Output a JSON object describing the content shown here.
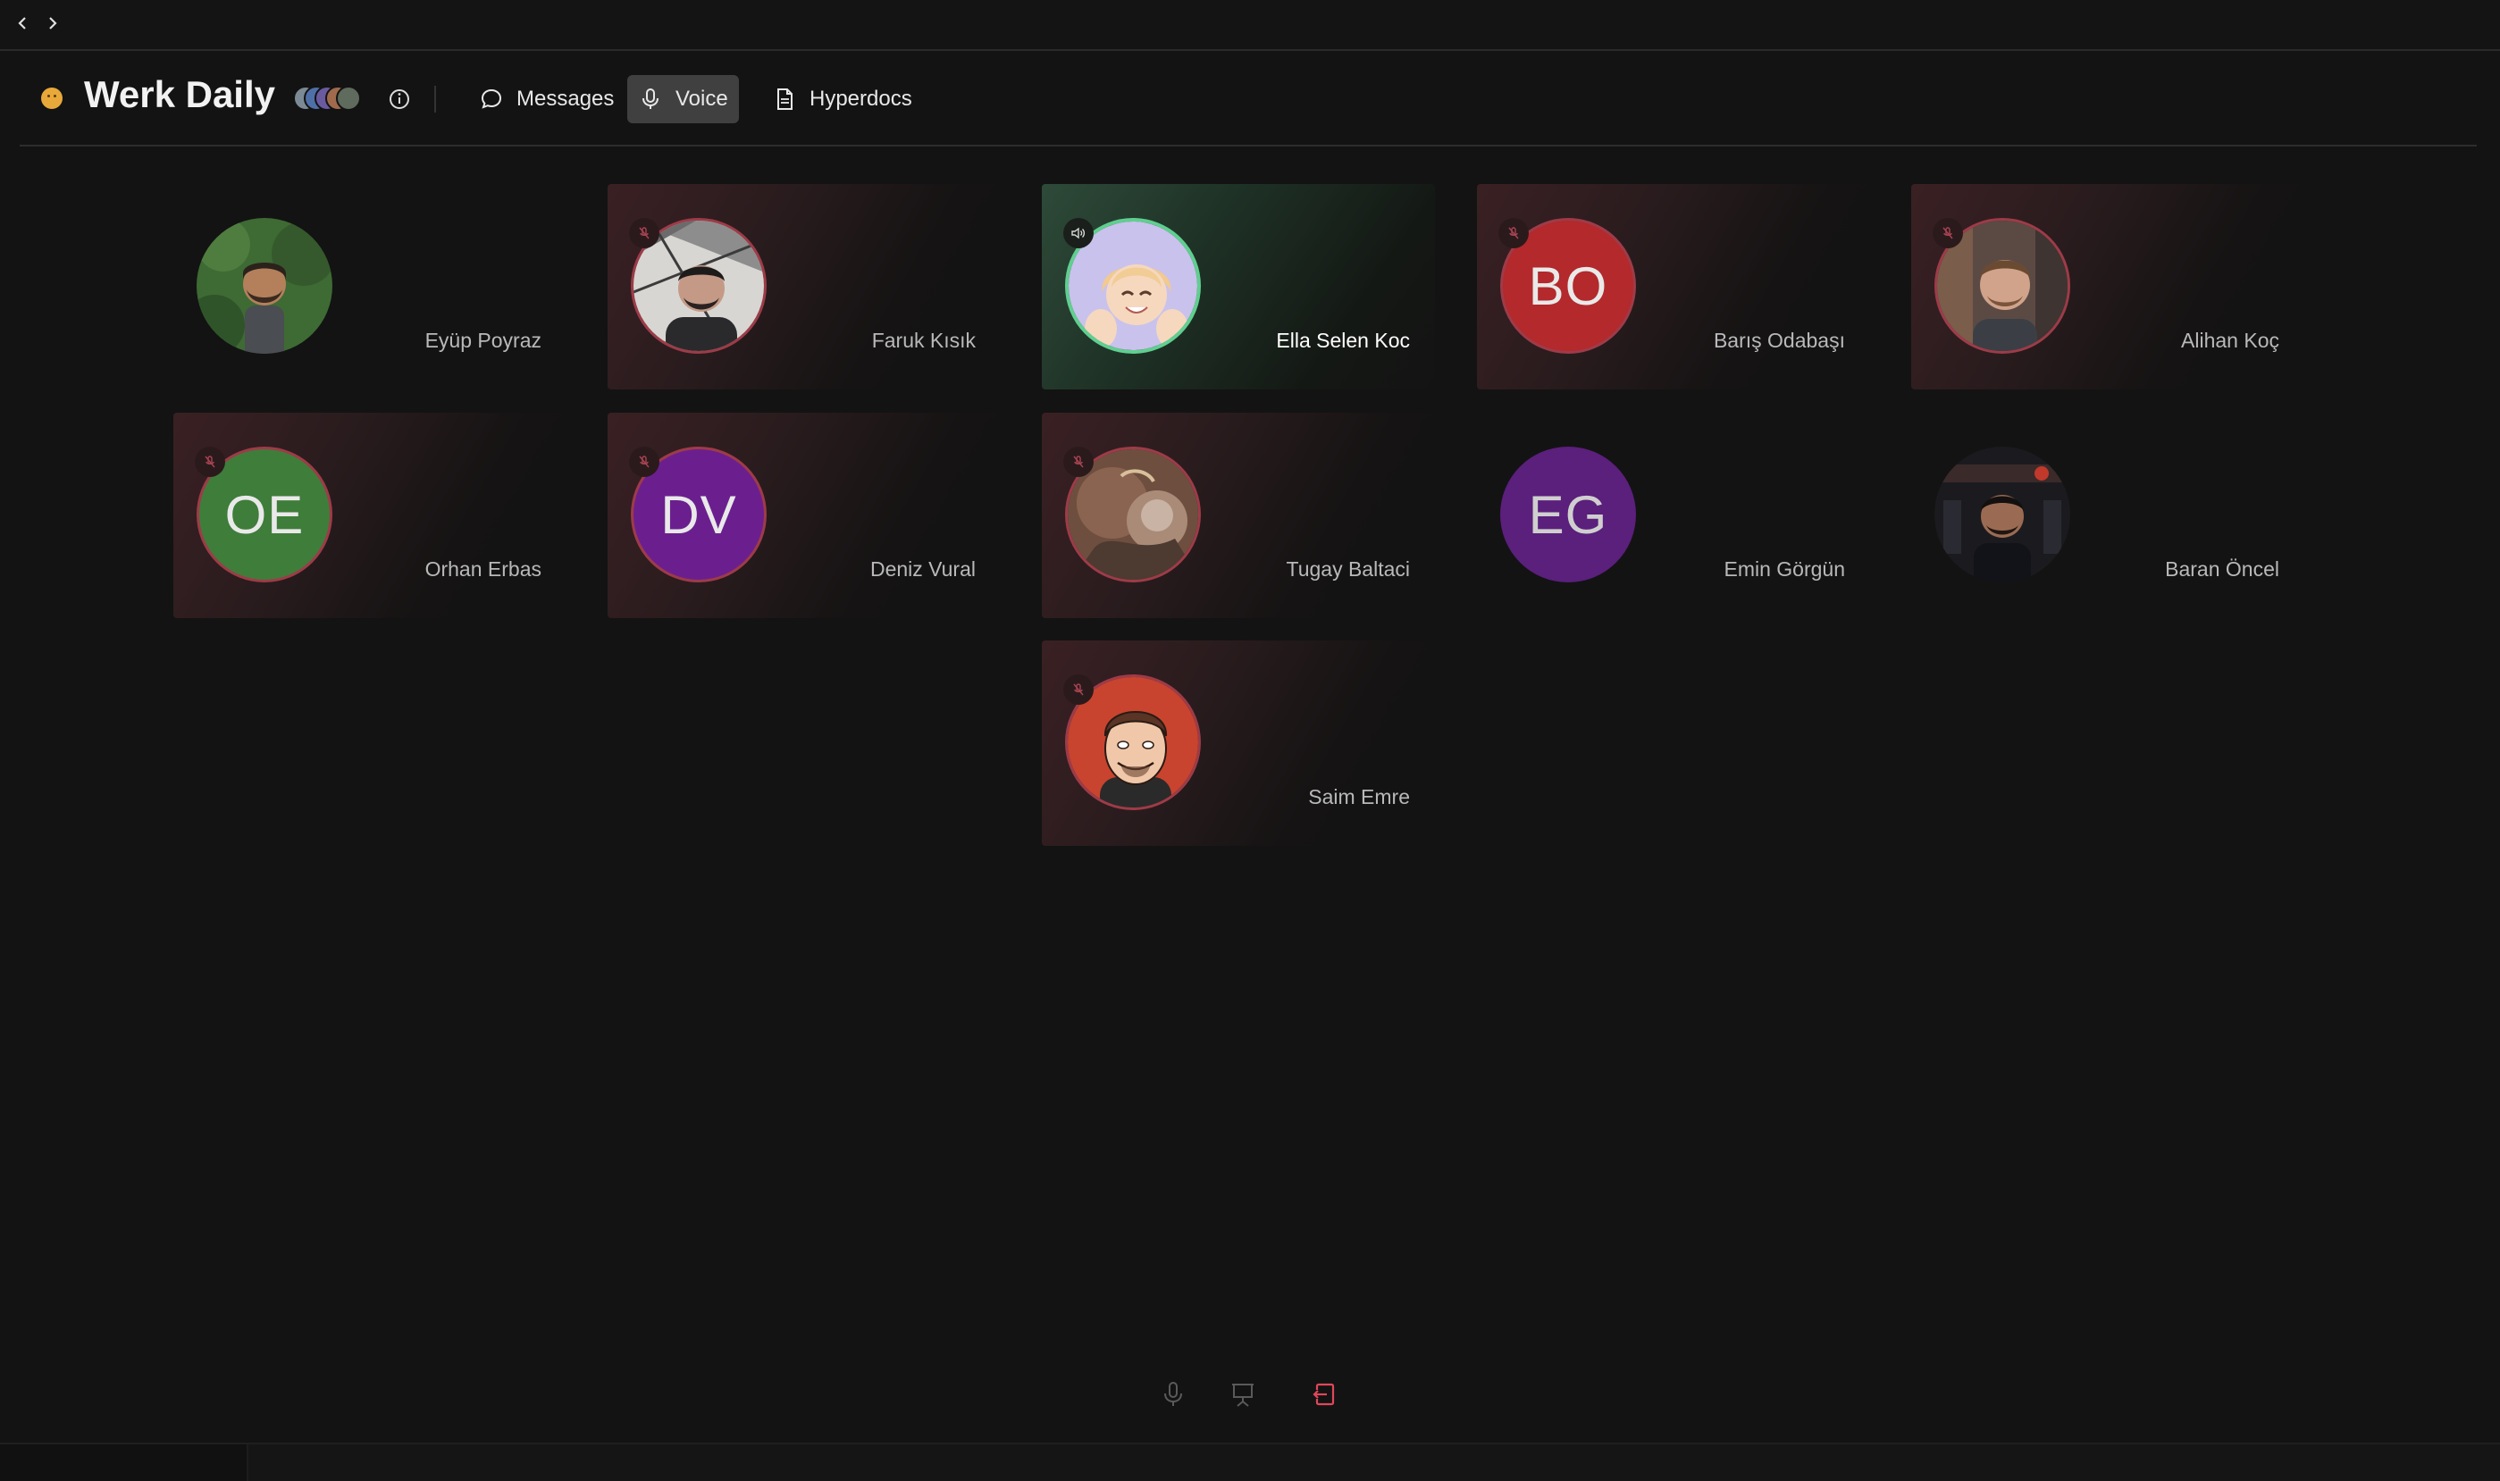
{
  "window": {
    "back_icon": "chevron-left-icon",
    "forward_icon": "chevron-right-icon"
  },
  "header": {
    "title": "Werk Daily",
    "status_icon": "slightly-smiling-emoji",
    "tabs": [
      {
        "label": "Messages",
        "icon": "message-bubble-icon",
        "active": false
      },
      {
        "label": "Voice",
        "icon": "microphone-icon",
        "active": true
      },
      {
        "label": "Hyperdocs",
        "icon": "document-icon",
        "active": false
      }
    ]
  },
  "participants": [
    {
      "name": "Eyüp Poyraz",
      "status": "plain",
      "avatar": "photo"
    },
    {
      "name": "Faruk Kısık",
      "status": "muted",
      "avatar": "photo"
    },
    {
      "name": "Ella Selen Koc",
      "status": "speaking",
      "avatar": "memoji"
    },
    {
      "name": "Barış Odabaşı",
      "status": "muted",
      "initials": "BO",
      "avatar_color": "#b3292c"
    },
    {
      "name": "Alihan Koç",
      "status": "muted",
      "avatar": "photo"
    },
    {
      "name": "Orhan Erbas",
      "status": "muted",
      "initials": "OE",
      "avatar_color": "#3f7d3a"
    },
    {
      "name": "Deniz Vural",
      "status": "muted",
      "initials": "DV",
      "avatar_color": "#6b1f8f"
    },
    {
      "name": "Tugay Baltaci",
      "status": "muted",
      "avatar": "photo"
    },
    {
      "name": "Emin Görgün",
      "status": "plain",
      "initials": "EG",
      "avatar_color": "#5b1f7c"
    },
    {
      "name": "Baran Öncel",
      "status": "plain",
      "avatar": "photo"
    },
    {
      "name": "Saim Emre",
      "status": "muted",
      "avatar": "cartoon"
    }
  ],
  "controls": {
    "mic_icon": "microphone-icon",
    "share_icon": "screen-share-icon",
    "leave_icon": "leave-call-icon"
  },
  "colors": {
    "muted_border": "#9e3b48",
    "speaking_border": "#5fcf8f",
    "leave": "#e0475a"
  }
}
